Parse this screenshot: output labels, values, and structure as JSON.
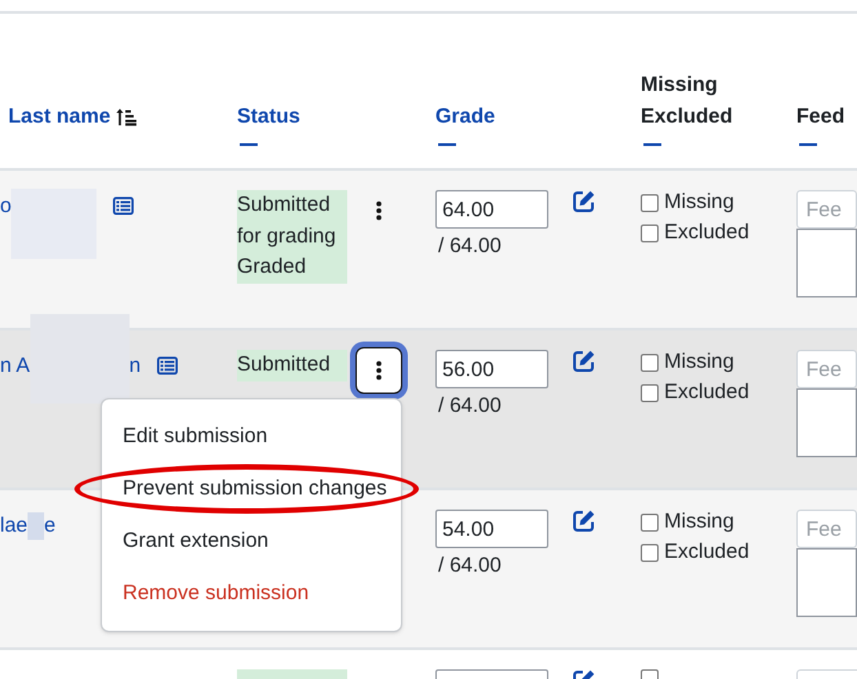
{
  "table": {
    "columns": [
      {
        "lines": [
          "Last name"
        ],
        "kind": "sorted-link"
      },
      {
        "lines": [
          "Status"
        ],
        "kind": "link"
      },
      {
        "lines": [
          "Grade"
        ],
        "kind": "link"
      },
      {
        "lines": [
          "Missing",
          "Excluded"
        ],
        "kind": "plain"
      },
      {
        "lines": [
          "Feed"
        ],
        "kind": "plain"
      }
    ],
    "rows": [
      {
        "kind": "full",
        "name_parts": [
          "o"
        ],
        "status": [
          "Submitted",
          "for grading",
          "Graded"
        ],
        "menu_open": false,
        "grade": "64.00",
        "max": "/ 64.00",
        "checks": [
          {
            "label": "Missing",
            "checked": false
          },
          {
            "label": "Excluded",
            "checked": false
          }
        ],
        "feedback_placeholder": "Fee"
      },
      {
        "kind": "full",
        "name_parts": [
          "n A",
          "n"
        ],
        "status": [
          "Submitted"
        ],
        "menu_open": true,
        "grade": "56.00",
        "max": "/ 64.00",
        "checks": [
          {
            "label": "Missing",
            "checked": false
          },
          {
            "label": "Excluded",
            "checked": false
          }
        ],
        "feedback_placeholder": "Fee"
      },
      {
        "kind": "full",
        "name_parts": [
          "lae",
          "e"
        ],
        "status": [],
        "grade": "54.00",
        "max": "/ 64.00",
        "checks": [
          {
            "label": "Missing",
            "checked": false
          },
          {
            "label": "Excluded",
            "checked": false
          }
        ],
        "feedback_placeholder": "Fee"
      },
      {
        "kind": "cut-off",
        "checked": false
      }
    ]
  },
  "menu": {
    "items": [
      {
        "label": "Edit submission",
        "danger": false,
        "circled": false
      },
      {
        "label": "Prevent submission changes",
        "danger": false,
        "circled": true
      },
      {
        "label": "Grant extension",
        "danger": false,
        "circled": false
      },
      {
        "label": "Remove submission",
        "danger": true,
        "circled": false
      }
    ]
  }
}
